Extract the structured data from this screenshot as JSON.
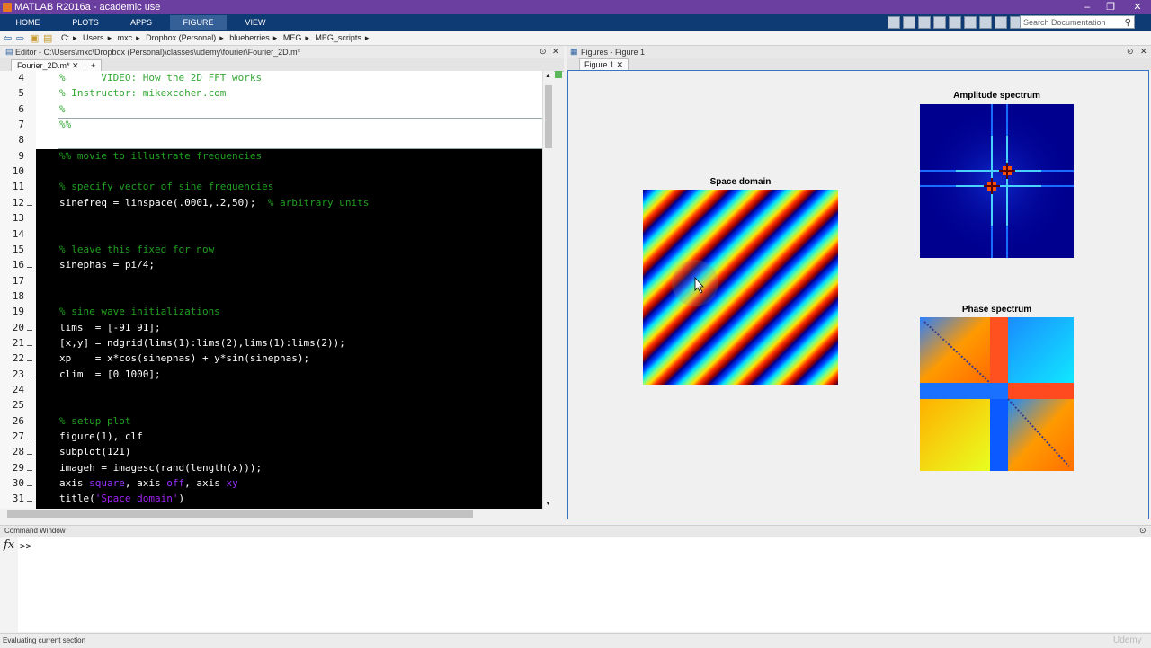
{
  "window": {
    "title": "MATLAB R2016a - academic use",
    "controls": [
      "–",
      "❐",
      "✕"
    ]
  },
  "ribbon": {
    "tabs": [
      {
        "label": "HOME",
        "active": false
      },
      {
        "label": "PLOTS",
        "active": false
      },
      {
        "label": "APPS",
        "active": false
      },
      {
        "label": "FIGURE",
        "active": true
      },
      {
        "label": "VIEW",
        "active": false
      }
    ],
    "search_placeholder": "Search Documentation"
  },
  "address": {
    "crumbs": [
      "C:",
      "▸",
      "Users",
      "▸",
      "mxc",
      "▸",
      "Dropbox (Personal)",
      "▸",
      "blueberries",
      "▸",
      "MEG",
      "▸",
      "MEG_scripts",
      "▸"
    ]
  },
  "editor": {
    "header": "Editor - C:\\Users\\mxc\\Dropbox (Personal)\\classes\\udemy\\fourier\\Fourier_2D.m*",
    "tab_label": "Fourier_2D.m*",
    "add_tab": "+",
    "lines": [
      {
        "n": "4",
        "text": "%      VIDEO: How the 2D FFT works",
        "kind": "comment-light"
      },
      {
        "n": "5",
        "text": "% Instructor: mikexcohen.com",
        "kind": "comment-light"
      },
      {
        "n": "6",
        "text": "%",
        "kind": "comment-light"
      },
      {
        "n": "7",
        "text": "%%",
        "kind": "comment-light"
      },
      {
        "n": "8",
        "text": "",
        "kind": "blank"
      },
      {
        "n": "9",
        "text": "%% movie to illustrate frequencies",
        "kind": "comment"
      },
      {
        "n": "10",
        "text": "",
        "kind": "blank"
      },
      {
        "n": "11",
        "text": "% specify vector of sine frequencies",
        "kind": "comment"
      },
      {
        "n": "12",
        "text": "sinefreq = linspace(.0001,.2,50);",
        "tail": "  % arbitrary units",
        "kind": "code"
      },
      {
        "n": "13",
        "text": "",
        "kind": "blank"
      },
      {
        "n": "14",
        "text": "",
        "kind": "blank"
      },
      {
        "n": "15",
        "text": "% leave this fixed for now",
        "kind": "comment"
      },
      {
        "n": "16",
        "text": "sinephas = pi/4;",
        "kind": "code"
      },
      {
        "n": "17",
        "text": "",
        "kind": "blank"
      },
      {
        "n": "18",
        "text": "",
        "kind": "blank"
      },
      {
        "n": "19",
        "text": "% sine wave initializations",
        "kind": "comment"
      },
      {
        "n": "20",
        "text": "lims  = [-91 91];",
        "kind": "code"
      },
      {
        "n": "21",
        "text": "[x,y] = ndgrid(lims(1):lims(2),lims(1):lims(2));",
        "kind": "code"
      },
      {
        "n": "22",
        "text": "xp    = x*cos(sinephas) + y*sin(sinephas);",
        "kind": "code"
      },
      {
        "n": "23",
        "text": "clim  = [0 1000];",
        "kind": "code"
      },
      {
        "n": "24",
        "text": "",
        "kind": "blank"
      },
      {
        "n": "25",
        "text": "",
        "kind": "blank"
      },
      {
        "n": "26",
        "text": "% setup plot",
        "kind": "comment"
      },
      {
        "n": "27",
        "text": "figure(1), clf",
        "kind": "code"
      },
      {
        "n": "28",
        "text": "subplot(121)",
        "kind": "code"
      },
      {
        "n": "29",
        "text": "imageh = imagesc(rand(length(x)));",
        "kind": "code"
      },
      {
        "n": "30",
        "text": "axis square, axis off, axis xy",
        "kind": "axis"
      },
      {
        "n": "31",
        "text": "title('Space domain')",
        "kind": "title"
      }
    ],
    "dash_lines": [
      "12",
      "16",
      "20",
      "21",
      "22",
      "23",
      "27",
      "28",
      "29",
      "30",
      "31"
    ]
  },
  "figures": {
    "header": "Figures - Figure 1",
    "tab_label": "Figure 1",
    "plots": {
      "space": {
        "title": "Space domain"
      },
      "amplitude": {
        "title": "Amplitude spectrum"
      },
      "phase": {
        "title": "Phase spectrum"
      }
    }
  },
  "command_window": {
    "header": "Command Window",
    "fx": "fx",
    "prompt": ">>"
  },
  "status": {
    "text": "Evaluating current section"
  },
  "watermark": "Udemy"
}
